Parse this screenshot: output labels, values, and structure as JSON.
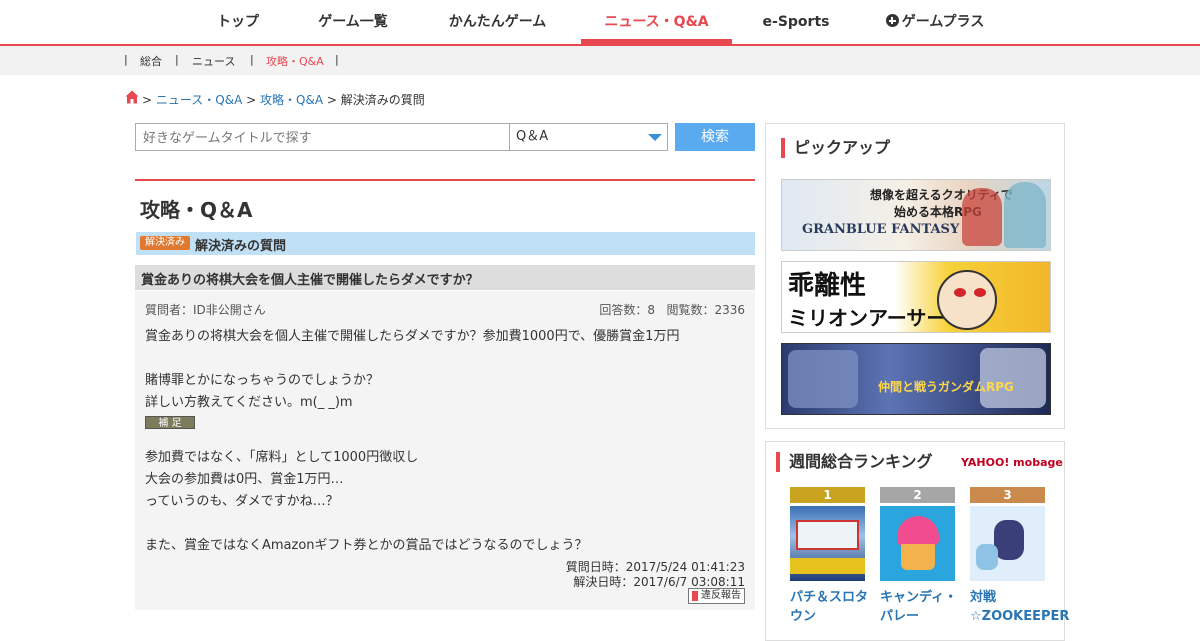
{
  "nav": {
    "items": [
      {
        "label": "トップ"
      },
      {
        "label": "ゲーム一覧"
      },
      {
        "label": "かんたんゲーム"
      },
      {
        "label": "ニュース・Q&A"
      },
      {
        "label": "e-Sports"
      },
      {
        "label": "ゲームプラス"
      }
    ],
    "active_index": 3,
    "accent_color": "#e8484f"
  },
  "subnav": {
    "items": [
      {
        "label": "総合"
      },
      {
        "label": "ニュース"
      },
      {
        "label": "攻略・Q&A"
      }
    ],
    "active_index": 2
  },
  "breadcrumb": {
    "items": [
      "ニュース・Q&A",
      "攻略・Q&A"
    ],
    "current": "解決済みの質問",
    "separator": ">"
  },
  "search": {
    "placeholder": "好きなゲームタイトルで探す",
    "category": "Q＆A",
    "button_label": "検索"
  },
  "page": {
    "title": "攻略・Q＆A",
    "resolved_badge": "解決済み",
    "resolved_heading": "解決済みの質問"
  },
  "question": {
    "title": "賞金ありの将棋大会を個人主催で開催したらダメですか？",
    "asker": "質問者：ID非公開さん",
    "answers": "回答数：8",
    "views": "閲覧数：2336",
    "body": [
      "賞金ありの将棋大会を個人主催で開催したらダメですか？参加費1000円で、優勝賞金1万円",
      "賭博罪とかになっちゃうのでしょうか？",
      "詳しい方教えてください。m(_ _)m"
    ],
    "supplement_label": "補 足",
    "supplement": [
      "参加費ではなく、「席料」として1000円徴収し",
      "大会の参加費は0円、賞金1万円…",
      "っていうのも、ダメですかね…？",
      "また、賞金ではなくAmazonギフト券とかの賞品ではどうなるのでしょう？"
    ],
    "asked_at": "質問日時：2017/5/24 01:41:23",
    "resolved_at": "解決日時：2017/6/7 03:08:11",
    "report_label": "違反報告"
  },
  "sidebar": {
    "pickup_heading": "ピックアップ",
    "banners": [
      {
        "lines": [
          "想像を超えるクオリティで",
          "始める本格RPG",
          "GRANBLUE FANTASY"
        ]
      },
      {
        "lines": [
          "乖離性",
          "ミリオンアーサー"
        ]
      },
      {
        "lines": [
          "仲間と戦うガンダムRPG"
        ]
      }
    ],
    "ranking_heading": "週間総合ランキング",
    "provider_logo": "YAHOO! mobage",
    "ranking": [
      {
        "rank": "1",
        "name": "パチ＆スロタウン",
        "badge_color": "#c9a21f"
      },
      {
        "rank": "2",
        "name": "キャンディ・パレー",
        "badge_color": "#a6a6a6"
      },
      {
        "rank": "3",
        "name": "対戦☆ZOOKEEPER",
        "badge_color": "#c98a4b"
      }
    ]
  }
}
